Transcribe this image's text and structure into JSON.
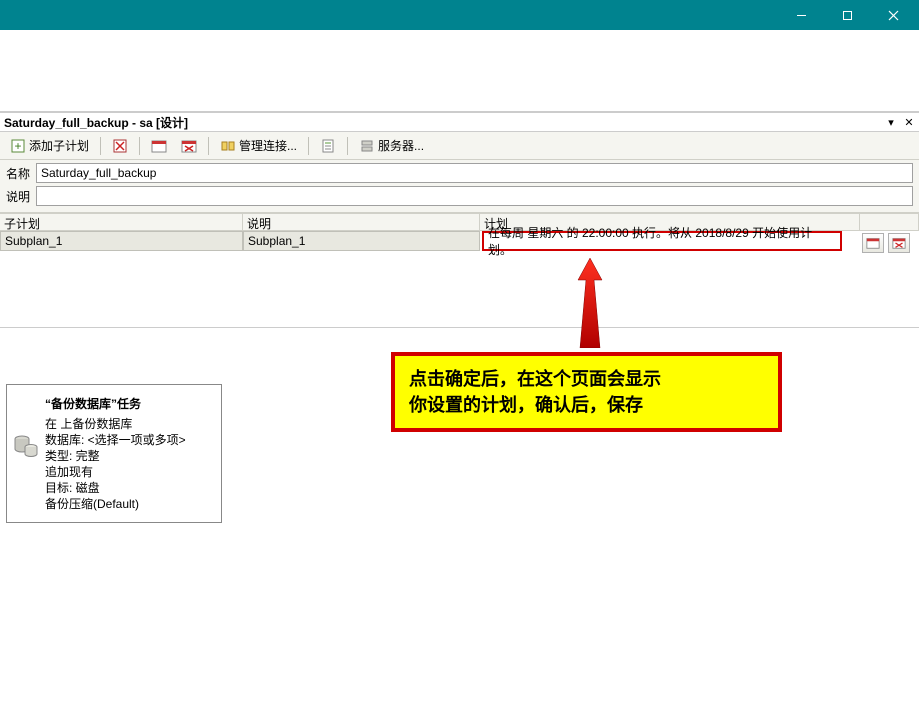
{
  "titlebar": {
    "minimize": "—",
    "maximize": "❐",
    "close": "✕"
  },
  "tab": {
    "title": "Saturday_full_backup - sa [设计]",
    "dropdown": "▾",
    "close": "✕"
  },
  "toolbar": {
    "add_subplan": "添加子计划",
    "manage_conn": "管理连接...",
    "servers": "服务器..."
  },
  "form": {
    "name_label": "名称",
    "name_value": "Saturday_full_backup",
    "desc_label": "说明",
    "desc_value": ""
  },
  "grid": {
    "headers": {
      "subplan": "子计划",
      "desc": "说明",
      "plan": "计划"
    },
    "row": {
      "subplan": "Subplan_1",
      "desc": "Subplan_1",
      "plan_text": "在每周 星期六 的 22:00:00 执行。将从 2018/8/29 开始使用计划。"
    }
  },
  "task_card": {
    "title": "“备份数据库”任务",
    "lines": [
      "在  上备份数据库",
      "数据库: <选择一项或多项>",
      "类型: 完整",
      "追加现有",
      "目标: 磁盘",
      "备份压缩(Default)"
    ]
  },
  "annotation": {
    "line1": "点击确定后，在这个页面会显示",
    "line2": "你设置的计划，确认后，保存"
  }
}
